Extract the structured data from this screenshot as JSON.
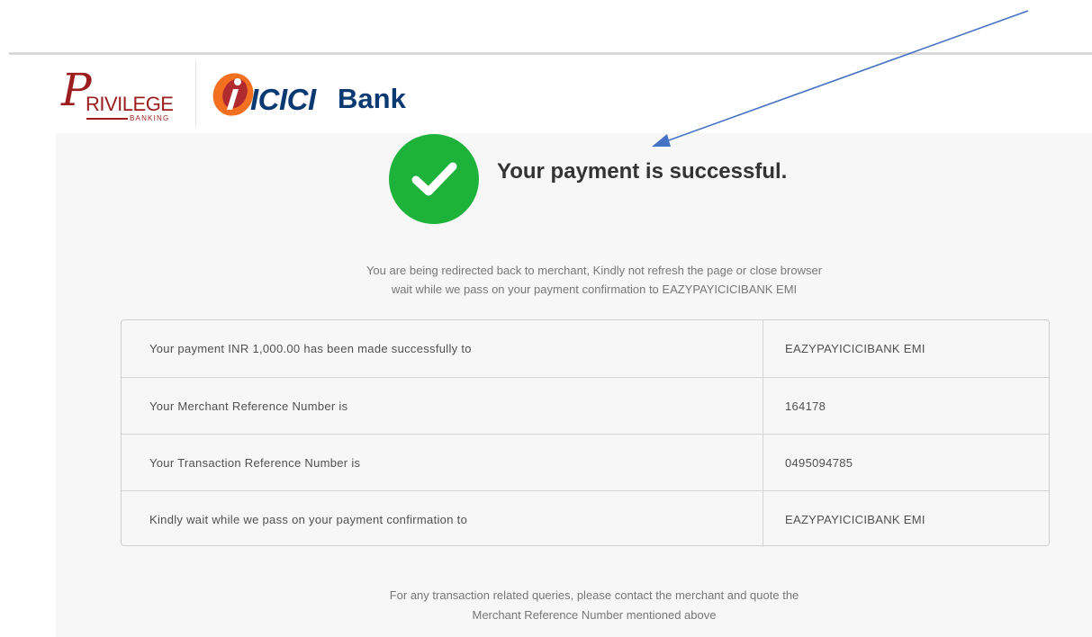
{
  "brand": {
    "privilege_initial": "P",
    "privilege_text": "RIVILEGE",
    "privilege_sub": "BANKING",
    "bank_word": "ICICI",
    "bank_suffix": "Bank",
    "colors": {
      "privilege": "#9c1d1d",
      "icici_blue": "#0b3a73",
      "icici_orange": "#f37021",
      "icici_red": "#b02a30"
    }
  },
  "status": {
    "icon": "check-circle-icon",
    "color": "#1db33a",
    "title": "Your payment is successful."
  },
  "redirect_note": {
    "line1": "You are being redirected back to merchant, Kindly not refresh the page or close browser",
    "line2": "wait while we pass on your payment confirmation to EAZYPAYICICIBANK EMI"
  },
  "details": {
    "rows": [
      {
        "label": "Your payment INR 1,000.00 has been made successfully to",
        "value": "EAZYPAYICICIBANK EMI"
      },
      {
        "label": "Your Merchant Reference Number is",
        "value": "164178"
      },
      {
        "label": "Your Transaction Reference Number is",
        "value": "0495094785"
      },
      {
        "label": "Kindly wait while we pass on your payment confirmation to",
        "value": "EAZYPAYICICIBANK EMI"
      }
    ]
  },
  "footer_note": {
    "line1": "For any transaction related queries, please contact the merchant and quote the",
    "line2": "Merchant Reference Number mentioned above"
  },
  "annotation": {
    "icon": "annotation-arrow-icon",
    "color": "#4472c4"
  }
}
